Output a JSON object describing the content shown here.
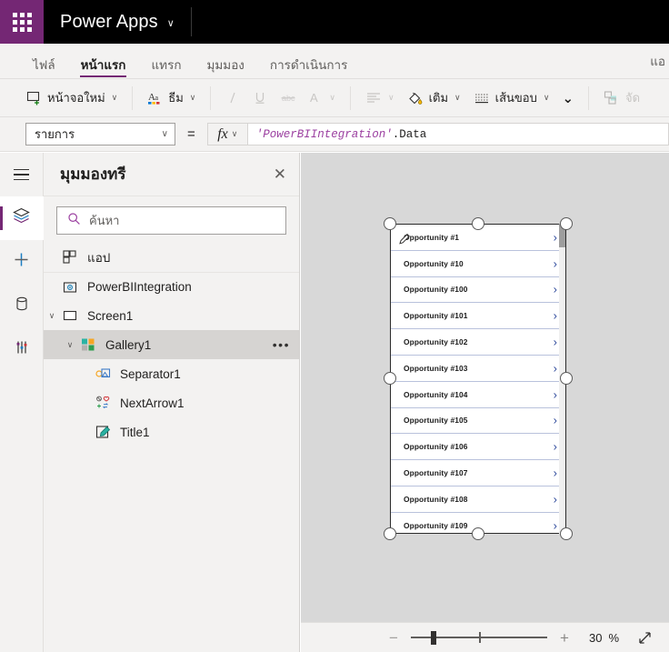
{
  "topbar": {
    "waffle_label": "App launcher",
    "brand": "Power Apps",
    "brand_caret": "∨"
  },
  "tabs": [
    {
      "label": "ไฟล์",
      "active": false
    },
    {
      "label": "หน้าแรก",
      "active": true
    },
    {
      "label": "แทรก",
      "active": false
    },
    {
      "label": "มุมมอง",
      "active": false
    },
    {
      "label": "การดำเนินการ",
      "active": false
    }
  ],
  "tab_right_label": "แอ",
  "ribbon": {
    "new_screen": "หน้าจอใหม่",
    "theme": "ธีม",
    "italic": "/",
    "underline": "U",
    "strikethrough": "abc",
    "font_color": "A",
    "align": "align",
    "fill": "เติม",
    "border": "เส้นขอบ",
    "more_caret": "⌄",
    "overflow_label": "จัด"
  },
  "formula_bar": {
    "property": "รายการ",
    "equals": "=",
    "fx": "fx",
    "formula_string": "'PowerBIIntegration'",
    "formula_property": ".Data"
  },
  "rail": {
    "items": [
      {
        "name": "hamburger",
        "selected": false
      },
      {
        "name": "layers",
        "selected": true
      },
      {
        "name": "insert-plus",
        "selected": false
      },
      {
        "name": "data-cylinder",
        "selected": false
      },
      {
        "name": "tools",
        "selected": false
      }
    ]
  },
  "tree": {
    "title": "มุมมองทรี",
    "close": "✕",
    "search_placeholder": "ค้นหา",
    "nodes": [
      {
        "label": "แอป",
        "icon": "app-icon",
        "indent": 0,
        "chev": "",
        "selected": false,
        "ellipsis": false,
        "topsep": false
      },
      {
        "label": "PowerBIIntegration",
        "icon": "powerbi-icon",
        "indent": 0,
        "chev": "",
        "selected": false,
        "ellipsis": false,
        "topsep": true
      },
      {
        "label": "Screen1",
        "icon": "screen-icon",
        "indent": 0,
        "chev": "∨",
        "selected": false,
        "ellipsis": false,
        "topsep": false
      },
      {
        "label": "Gallery1",
        "icon": "gallery-icon",
        "indent": 1,
        "chev": "∨",
        "selected": true,
        "ellipsis": true,
        "topsep": false
      },
      {
        "label": "Separator1",
        "icon": "separator-icon",
        "indent": 2,
        "chev": "",
        "selected": false,
        "ellipsis": false,
        "topsep": false
      },
      {
        "label": "NextArrow1",
        "icon": "nextarrow-icon",
        "indent": 2,
        "chev": "",
        "selected": false,
        "ellipsis": false,
        "topsep": false
      },
      {
        "label": "Title1",
        "icon": "title-icon",
        "indent": 2,
        "chev": "",
        "selected": false,
        "ellipsis": false,
        "topsep": false
      }
    ],
    "node_ellipsis": "•••"
  },
  "gallery": {
    "chevron": "›",
    "items": [
      "Opportunity #1",
      "Opportunity #10",
      "Opportunity #100",
      "Opportunity #101",
      "Opportunity #102",
      "Opportunity #103",
      "Opportunity #104",
      "Opportunity #105",
      "Opportunity #106",
      "Opportunity #107",
      "Opportunity #108",
      "Opportunity #109"
    ]
  },
  "zoombar": {
    "minus": "−",
    "plus": "+",
    "value": "30",
    "percent": "%",
    "fit_label": "fit-to-screen"
  },
  "colors": {
    "brand_purple": "#742774",
    "topbar_black": "#000000",
    "chrome_gray": "#f3f2f1",
    "canvas_gray": "#d8d8d8",
    "chevron_blue": "#2f4a9c",
    "row_divider": "#b9c2dc"
  }
}
